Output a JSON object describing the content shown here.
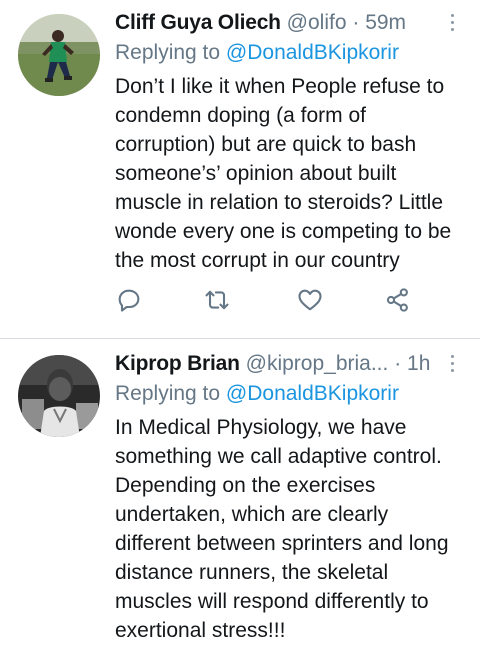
{
  "tweets": [
    {
      "display_name": "Cliff Guya Oliech",
      "handle": "@olifo",
      "separator": "·",
      "time": "59m",
      "replying_prefix": "Replying to",
      "replying_to": "@DonaldBKipkorir",
      "text": "Don’t I like it when People refuse to condemn doping (a form of corruption) but are quick to bash someone’s’ opinion about built muscle in relation to steroids? Little wonde every one is competing to be the most corrupt in our country",
      "actions": [
        "reply-icon",
        "retweet-icon",
        "like-icon",
        "share-icon"
      ]
    },
    {
      "display_name": "Kiprop Brian",
      "handle": "@kiprop_bria...",
      "separator": "·",
      "time": "1h",
      "replying_prefix": "Replying to",
      "replying_to": "@DonaldBKipkorir",
      "text": "In Medical Physiology, we have something we call adaptive control. Depending on the exercises undertaken, which are clearly different between sprinters and long distance runners, the skeletal muscles will respond differently to exertional stress!!!"
    }
  ],
  "colors": {
    "link": "#1b95e0",
    "secondary_text": "#657786",
    "icon": "#657786",
    "divider": "#d9dde1"
  }
}
